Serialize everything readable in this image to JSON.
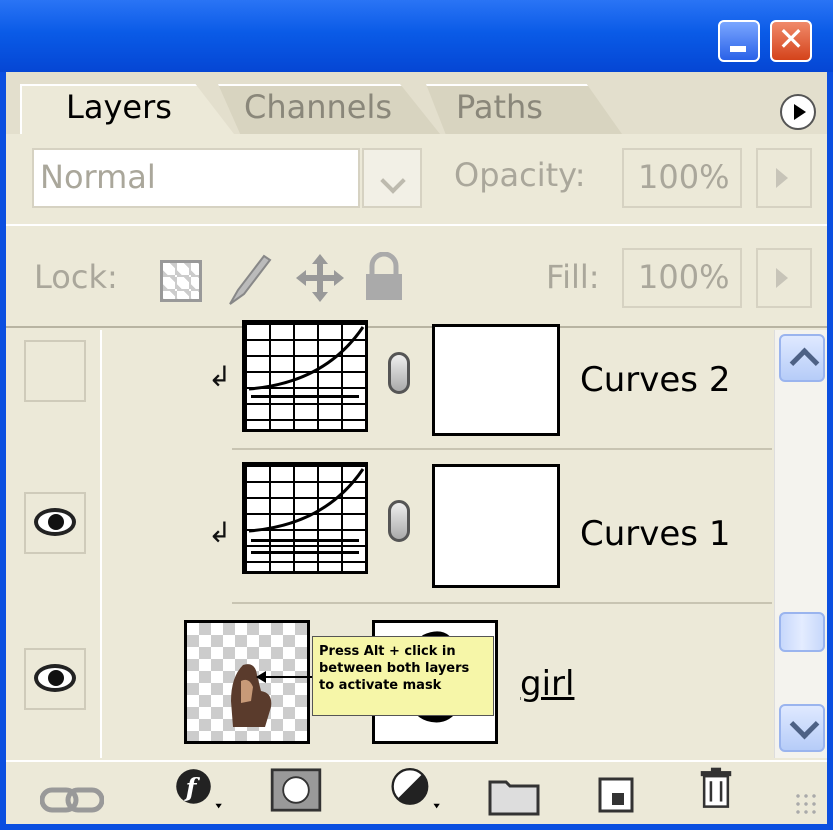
{
  "window": {
    "minimize_icon": "minimize-icon",
    "close_glyph": "✕"
  },
  "tabs": [
    {
      "label": "Layers",
      "active": true
    },
    {
      "label": "Channels",
      "active": false
    },
    {
      "label": "Paths",
      "active": false
    }
  ],
  "blend": {
    "mode": "Normal",
    "opacity_label": "Opacity:",
    "opacity_value": "100%"
  },
  "lock": {
    "label": "Lock:",
    "fill_label": "Fill:",
    "fill_value": "100%",
    "icons": [
      "lock-transparent-icon",
      "lock-image-icon",
      "lock-position-icon",
      "lock-all-icon"
    ]
  },
  "layers": [
    {
      "name": "Curves 2",
      "visible": false,
      "type": "curves"
    },
    {
      "name": "Curves 1",
      "visible": true,
      "type": "curves"
    },
    {
      "name": "girl",
      "visible": true,
      "type": "image"
    }
  ],
  "tooltip": {
    "text": "Press Alt + click in between both layers to activate mask"
  },
  "toolbar": {
    "icons": [
      "link-layers-icon",
      "layer-style-icon",
      "add-mask-icon",
      "adjustment-layer-icon",
      "new-group-icon",
      "new-layer-icon",
      "delete-layer-icon"
    ]
  },
  "colors": {
    "titlebar": "#0a5be7",
    "panel": "#ece9d8",
    "tooltip": "#f6f6a8"
  }
}
